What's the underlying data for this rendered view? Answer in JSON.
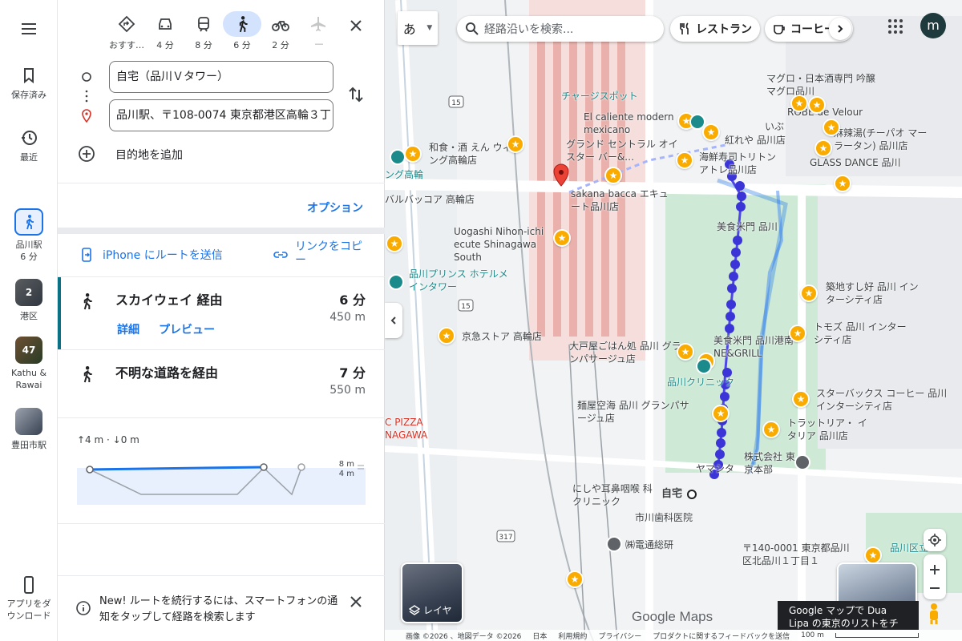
{
  "rail": {
    "menu_icon": "menu-icon",
    "saved": "保存済み",
    "recent": "最近",
    "current_route": {
      "line1": "品川駅",
      "line2": "6 分"
    },
    "places": [
      {
        "label": "港区",
        "count": "2"
      },
      {
        "label": "Kathu & Rawai",
        "count": "47"
      },
      {
        "label": "豊田市駅",
        "count": ""
      }
    ],
    "download": "アプリをダウンロード"
  },
  "modes": [
    {
      "icon": "directions-icon",
      "label": "おすす…"
    },
    {
      "icon": "car-icon",
      "label": "4 分"
    },
    {
      "icon": "train-icon",
      "label": "8 分"
    },
    {
      "icon": "walk-icon",
      "label": "6 分"
    },
    {
      "icon": "bicycle-icon",
      "label": "2 分"
    },
    {
      "icon": "flight-icon",
      "label": "—"
    }
  ],
  "origin": "自宅（品川Ｖタワー）",
  "destination": "品川駅、〒108-0074 東京都港区高輪３丁目",
  "add_destination": "目的地を追加",
  "options": "オプション",
  "send_to_phone": "iPhone にルートを送信",
  "copy_link": "リンクをコピー",
  "routes": [
    {
      "name": "スカイウェイ 経由",
      "time": "6 分",
      "distance": "450 m",
      "details": "詳細",
      "preview": "プレビュー"
    },
    {
      "name": "不明な道路を経由",
      "time": "7 分",
      "distance": "550 m"
    }
  ],
  "elevation": {
    "summary": "↑4 m · ↓0 m",
    "max": "8 m",
    "min": "4 m"
  },
  "notice": "New! ルートを続行するには、スマートフォンの通知をタップして経路を検索します",
  "map": {
    "lang_toggle": "あ",
    "search_placeholder": "経路沿いを検索...",
    "chip_restaurant": "レストラン",
    "chip_coffee": "コーヒー",
    "avatar": "m",
    "layers": "レイヤ",
    "google_logo": "Google Maps",
    "promo": "Google マップで Dua Lipa の東京のリストをチェック",
    "labels": {
      "charge": "チャージスポット",
      "caliente": "El caliente modern mexicano",
      "washoku": "和食・酒 えん ウィング高輪店",
      "grand": "グランド セントラル オイスター バー&…",
      "kaisen": "海鮮寿司トリトン アトレ品川店",
      "hareya": "紅れや 品川店",
      "maguro": "マグロ・日本酒専門 吟醸マグロ品川",
      "robe": "ROBE de Velour",
      "ibu": "いぶ",
      "mala": "麻辣湯(チーパオ マーラータン) 品川店",
      "glass": "GLASS DANCE 品川",
      "bacca": "sakana bacca エキュート品川店",
      "barcoa": "バルバッコア 高輪店",
      "uogashi": "Uogashi Nihon-ichi ecute Shinagawa South",
      "bimi": "美食米門 品川",
      "prince": "品川プリンス ホテルメインタワー",
      "tsukiji": "築地すし好 品川 インターシティ店",
      "tomoz": "トモズ 品川 インターシティ店",
      "kyukyu": "京急ストア 高輪店",
      "ootoya": "大戸屋ごはん処 品川 グランパサージュ店",
      "bimi2": "美食米門 品川港南 NE&GRILL",
      "clinic": "品川クリニック",
      "starbucks": "スターバックス コーヒー 品川インターシティ店",
      "menya": "麺屋空海 品川 グランパサージュ店",
      "trattoria": "トラットリア・ イタリア 品川店",
      "yamato": "ヤマシタ",
      "kaisha": "株式会社 東京本部",
      "jitaku": "自宅",
      "ear": "にしや耳鼻咽喉 科クリニック",
      "dental": "市川歯科医院",
      "dentsu": "㈱電通総研",
      "address": "〒140-0001 東京都品川 区北品川１丁目１",
      "pizza": "C PIZZA NAGAWA",
      "wing": "ング高輪",
      "shinagawa_park": "品川区立"
    },
    "road_numbers": {
      "r15": "15",
      "r317": "317"
    },
    "footer": [
      "画像 ©2026 、地図データ ©2026",
      "日本",
      "利用規約",
      "プライバシー",
      "プロダクトに関するフィードバックを送信",
      "100 m"
    ]
  }
}
